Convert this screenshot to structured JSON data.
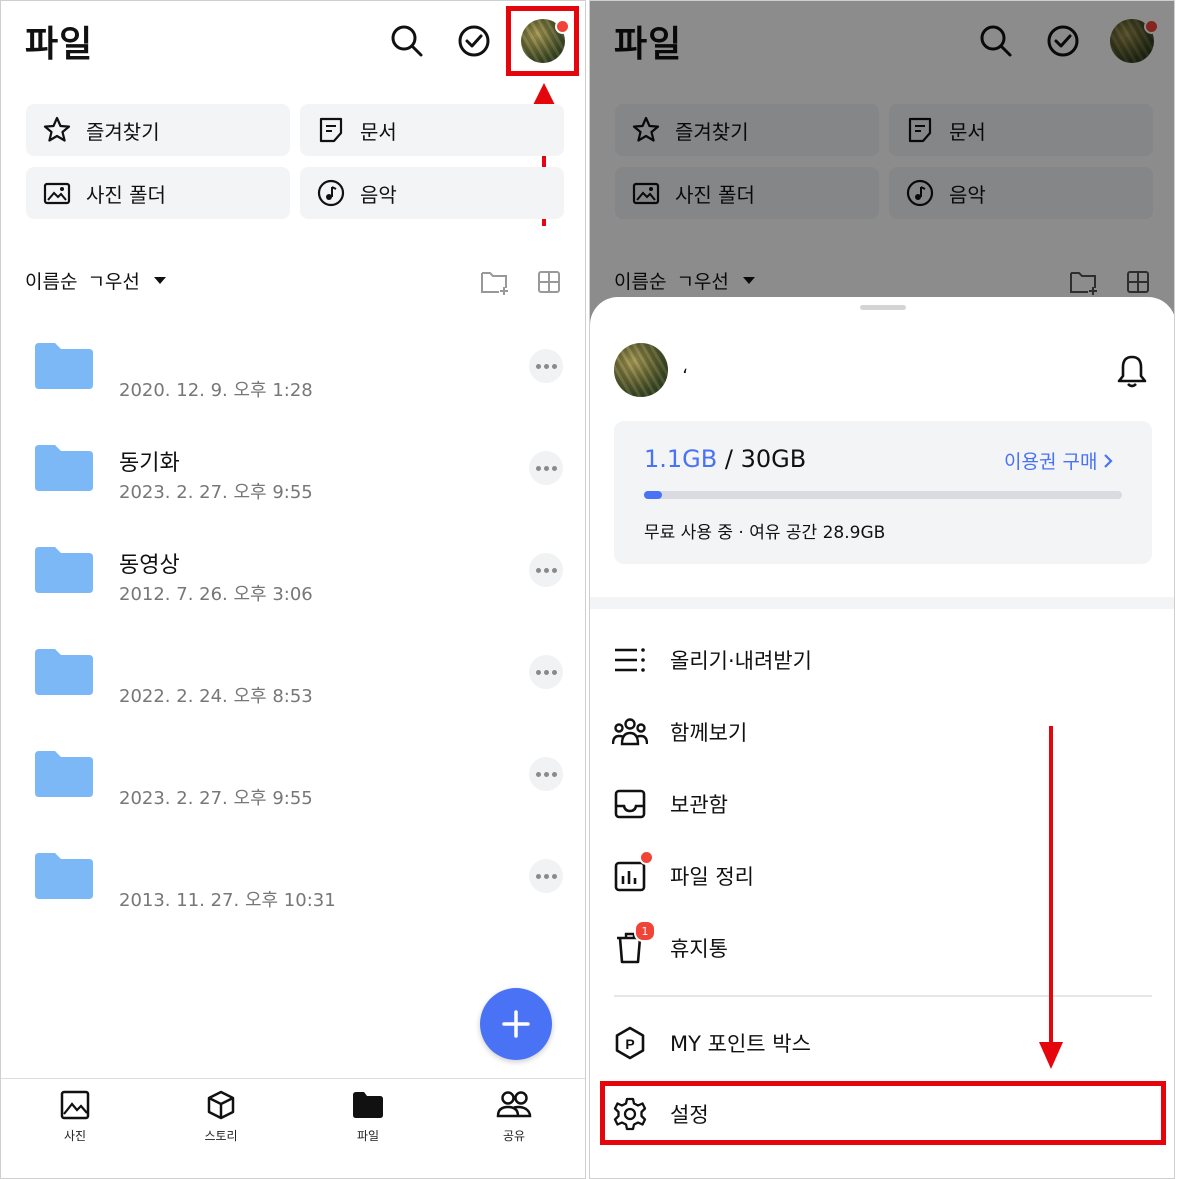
{
  "left": {
    "title": "파일",
    "quick": [
      {
        "label": "즐겨찾기",
        "icon": "star-icon"
      },
      {
        "label": "문서",
        "icon": "document-icon"
      },
      {
        "label": "사진 폴더",
        "icon": "photo-folder-icon"
      },
      {
        "label": "음악",
        "icon": "music-icon"
      }
    ],
    "sort": {
      "label": "이름순",
      "order": "ㄱ우선"
    },
    "folders": [
      {
        "name": "",
        "date": "2020. 12. 9. 오후 1:28"
      },
      {
        "name": "동기화",
        "date": "2023. 2. 27. 오후 9:55"
      },
      {
        "name": "동영상",
        "date": "2012. 7. 26. 오후 3:06"
      },
      {
        "name": "",
        "date": "2022. 2. 24. 오후 8:53"
      },
      {
        "name": "",
        "date": "2023. 2. 27. 오후 9:55"
      },
      {
        "name": "",
        "date": "2013. 11. 27. 오후 10:31"
      }
    ],
    "tabs": [
      {
        "label": "사진",
        "icon": "photo-icon"
      },
      {
        "label": "스토리",
        "icon": "cube-icon"
      },
      {
        "label": "파일",
        "icon": "folder-icon"
      },
      {
        "label": "공유",
        "icon": "people-icon"
      }
    ]
  },
  "right": {
    "title": "파일",
    "quick": [
      {
        "label": "즐겨찾기"
      },
      {
        "label": "문서"
      },
      {
        "label": "사진 폴더"
      },
      {
        "label": "음악"
      }
    ],
    "sort": {
      "label": "이름순",
      "order": "ㄱ우선"
    },
    "sheet": {
      "username": "،",
      "storage": {
        "used": "1.1GB",
        "separator": " / ",
        "total": "30GB",
        "used_fraction": 0.037,
        "purchase_label": "이용권 구매",
        "status": "무료 사용 중 · 여유 공간 28.9GB"
      },
      "menu": [
        {
          "label": "올리기·내려받기",
          "icon": "transfer-list-icon"
        },
        {
          "label": "함께보기",
          "icon": "group-icon"
        },
        {
          "label": "보관함",
          "icon": "inbox-icon"
        },
        {
          "label": "파일 정리",
          "icon": "chart-icon"
        },
        {
          "label": "휴지통",
          "icon": "trash-icon",
          "badge": "1"
        }
      ],
      "menu2": [
        {
          "label": "MY 포인트 박스",
          "icon": "point-icon"
        },
        {
          "label": "설정",
          "icon": "gear-icon"
        }
      ]
    }
  },
  "colors": {
    "accent": "#4a72f5",
    "highlight": "#e5060d",
    "badge": "#f04438",
    "folder": "#7bb8f5"
  }
}
